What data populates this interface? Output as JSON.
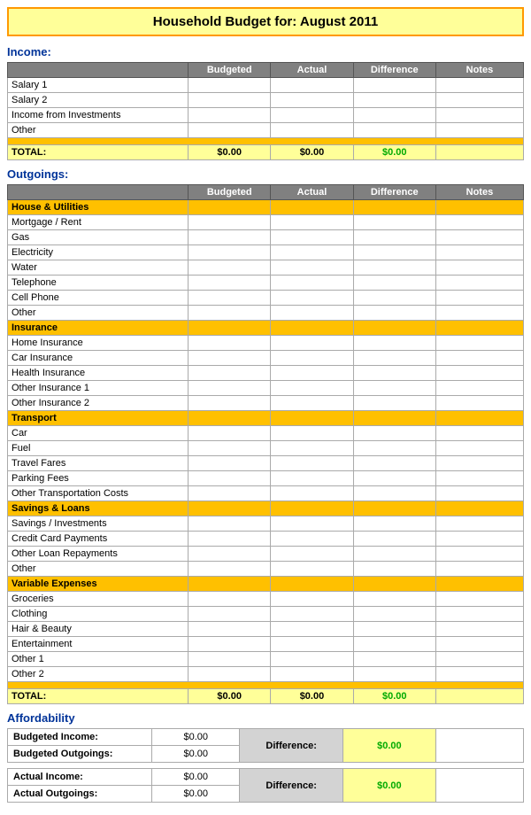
{
  "title": {
    "prefix": "Household Budget for:",
    "month": "August 2011",
    "full": "Household Budget for:   August 2011"
  },
  "income": {
    "section_label": "Income:",
    "headers": [
      "",
      "Budgeted",
      "Actual",
      "Difference",
      "Notes"
    ],
    "rows": [
      {
        "label": "Salary 1",
        "budgeted": "",
        "actual": "",
        "difference": "",
        "notes": ""
      },
      {
        "label": "Salary 2",
        "budgeted": "",
        "actual": "",
        "difference": "",
        "notes": ""
      },
      {
        "label": "Income from Investments",
        "budgeted": "",
        "actual": "",
        "difference": "",
        "notes": ""
      },
      {
        "label": "Other",
        "budgeted": "",
        "actual": "",
        "difference": "",
        "notes": ""
      }
    ],
    "total_label": "TOTAL:",
    "total_budgeted": "$0.00",
    "total_actual": "$0.00",
    "total_difference": "$0.00"
  },
  "outgoings": {
    "section_label": "Outgoings:",
    "headers": [
      "",
      "Budgeted",
      "Actual",
      "Difference",
      "Notes"
    ],
    "categories": [
      {
        "name": "House & Utilities",
        "rows": [
          "Mortgage / Rent",
          "Gas",
          "Electricity",
          "Water",
          "Telephone",
          "Cell Phone",
          "Other"
        ]
      },
      {
        "name": "Insurance",
        "rows": [
          "Home Insurance",
          "Car Insurance",
          "Health Insurance",
          "Other Insurance 1",
          "Other Insurance 2"
        ]
      },
      {
        "name": "Transport",
        "rows": [
          "Car",
          "Fuel",
          "Travel Fares",
          "Parking Fees",
          "Other Transportation Costs"
        ]
      },
      {
        "name": "Savings & Loans",
        "rows": [
          "Savings / Investments",
          "Credit Card Payments",
          "Other Loan Repayments",
          "Other"
        ]
      },
      {
        "name": "Variable Expenses",
        "rows": [
          "Groceries",
          "Clothing",
          "Hair & Beauty",
          "Entertainment",
          "Other 1",
          "Other 2"
        ]
      }
    ],
    "total_label": "TOTAL:",
    "total_budgeted": "$0.00",
    "total_actual": "$0.00",
    "total_difference": "$0.00"
  },
  "affordability": {
    "section_label": "Affordability",
    "budgeted_income_label": "Budgeted Income:",
    "budgeted_income_val": "$0.00",
    "budgeted_outgoings_label": "Budgeted Outgoings:",
    "budgeted_outgoings_val": "$0.00",
    "budgeted_diff_label": "Difference:",
    "budgeted_diff_val": "$0.00",
    "actual_income_label": "Actual Income:",
    "actual_income_val": "$0.00",
    "actual_outgoings_label": "Actual Outgoings:",
    "actual_outgoings_val": "$0.00",
    "actual_diff_label": "Difference:",
    "actual_diff_val": "$0.00"
  }
}
